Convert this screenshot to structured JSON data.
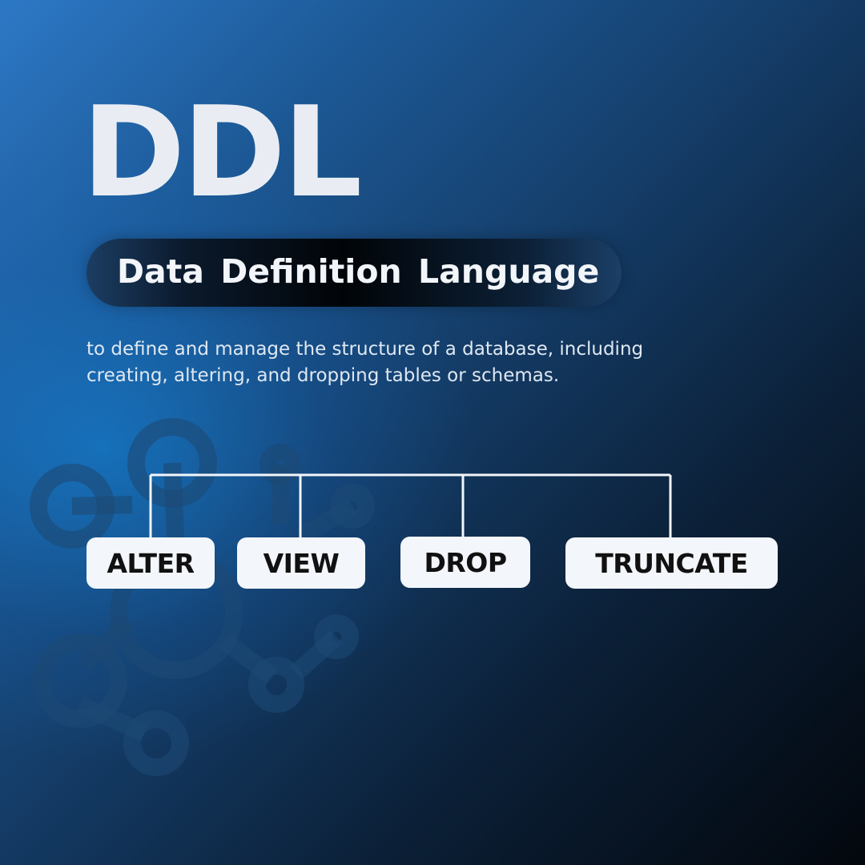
{
  "title": "DDL",
  "subtitle": "Data Definition Language",
  "description": "to define and manage the structure of a database, including creating, altering, and dropping tables or schemas.",
  "commands": [
    "ALTER",
    "VIEW",
    "DROP",
    "TRUNCATE"
  ],
  "colors": {
    "title_text": "#e9edf3",
    "box_fill": "#f3f6fa",
    "box_text": "#111111",
    "connector_line": "#f3f6fa",
    "background_light": "#2d78c6",
    "background_dark": "#03070d"
  },
  "background_decoration": "molecule-network-icon"
}
